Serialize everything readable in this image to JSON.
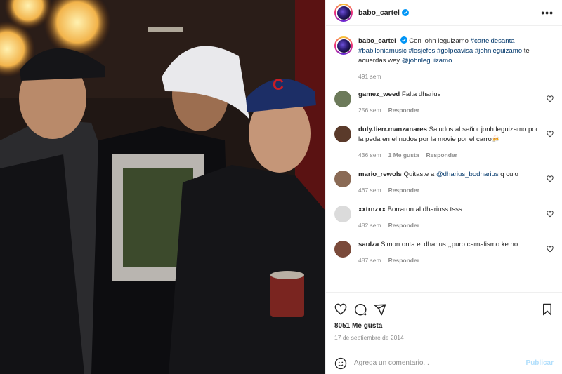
{
  "post": {
    "username": "babo_cartel",
    "more_label": "•••",
    "caption": {
      "author": "babo_cartel",
      "text_prefix": "Con john leguizamo ",
      "tags": "#carteldesanta #babiloniamusic #losjefes #golpeavisa #johnleguizamo",
      "text_middle": " te acuerdas wey ",
      "mention": "@johnleguizamo",
      "time": "491 sem"
    },
    "comments": [
      {
        "author": "gamez_weed",
        "text": "Falta dharius",
        "time": "256 sem",
        "likes": "",
        "reply": "Responder",
        "avatar_color": "#6c7a5a"
      },
      {
        "author": "duly.tierr.manzanares",
        "text": "Saludos al señor jonh leguizamo por la peda en el nudos por la movie por el carro🍻",
        "time": "436 sem",
        "likes": "1 Me gusta",
        "reply": "Responder",
        "avatar_color": "#5a3a2a"
      },
      {
        "author": "mario_rewols",
        "text_prefix": "Quitaste a ",
        "mention": "@dharius_bodharius",
        "text_suffix": " q culo",
        "time": "467 sem",
        "likes": "",
        "reply": "Responder",
        "avatar_color": "#8a6a55"
      },
      {
        "author": "xxtrnzxx",
        "text": "Borraron al dhariuss tsss",
        "time": "482 sem",
        "likes": "",
        "reply": "Responder",
        "avatar_color": "#dbdbdb"
      },
      {
        "author": "saulza",
        "text": "Simon onta el dharius ,,puro carnalismo ke no",
        "time": "487 sem",
        "likes": "",
        "reply": "Responder",
        "avatar_color": "#7a4a3a"
      }
    ],
    "likes_label": "8051 Me gusta",
    "date": "17 de septiembre de 2014",
    "add_comment_placeholder": "Agrega un comentario...",
    "post_button": "Publicar"
  },
  "icons": {
    "like": "heart-icon",
    "comment": "comment-icon",
    "share": "share-icon",
    "save": "bookmark-icon",
    "emoji": "emoji-icon",
    "verified": "verified-badge-icon"
  },
  "colors": {
    "link": "#00376b",
    "muted": "#8e8e8e",
    "verified": "#0095f6",
    "post_disabled": "#b2dffc"
  }
}
